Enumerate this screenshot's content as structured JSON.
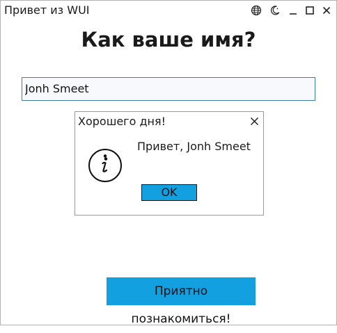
{
  "window": {
    "title": "Привет из WUI",
    "titlebar_icons": [
      "globe-icon",
      "theme-icon",
      "minimize-icon",
      "maximize-icon",
      "close-icon"
    ]
  },
  "main": {
    "heading": "Как ваше имя?",
    "name_input": {
      "value": "Jonh Smeet",
      "placeholder": ""
    },
    "greet_button_label": "Приятно познакомиться!"
  },
  "dialog": {
    "title": "Хорошего дня!",
    "message": "Привет, Jonh Smeet",
    "ok_label": "OK",
    "icon": "info-icon"
  },
  "colors": {
    "accent": "#12a0e0",
    "input_border": "#3b7ea8",
    "text": "#1a1a1a"
  }
}
